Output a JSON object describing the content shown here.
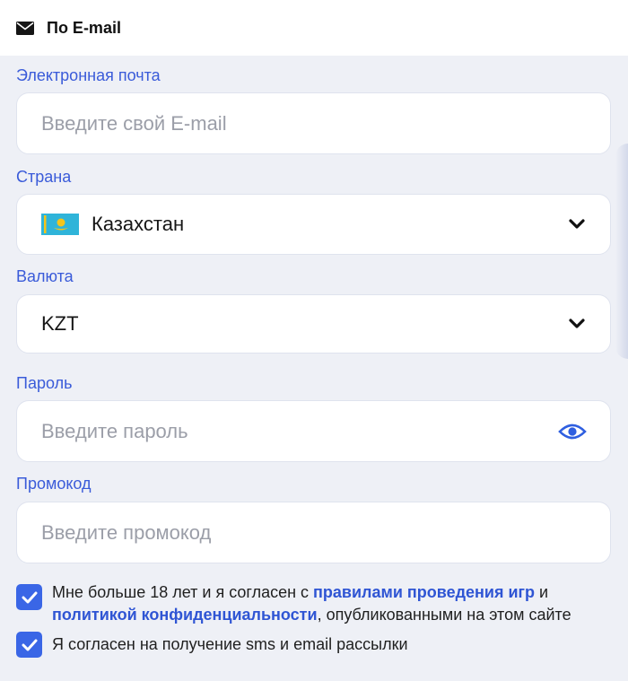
{
  "tab": {
    "label": "По E-mail",
    "icon": "envelope-icon"
  },
  "fields": {
    "email": {
      "label": "Электронная почта",
      "placeholder": "Введите свой E-mail"
    },
    "country": {
      "label": "Страна",
      "value": "Казахстан",
      "icon": "kazakhstan-flag-icon"
    },
    "currency": {
      "label": "Валюта",
      "value": "KZT"
    },
    "password": {
      "label": "Пароль",
      "placeholder": "Введите пароль",
      "icon": "eye-icon"
    },
    "promo": {
      "label": "Промокод",
      "placeholder": "Введите промокод"
    }
  },
  "agreements": {
    "terms": {
      "checked": true,
      "text_before": "Мне больше 18 лет и я согласен с ",
      "link_rules": "правилами проведения игр",
      "text_middle": " и ",
      "link_privacy": "политикой конфиденциальности",
      "text_after": ", опубликованными на этом сайте"
    },
    "mailing": {
      "checked": true,
      "text": "Я согласен на получение sms и email рассылки"
    }
  },
  "colors": {
    "accent": "#3a66e6",
    "label": "#3a5bd9",
    "background": "#eef0f6"
  }
}
